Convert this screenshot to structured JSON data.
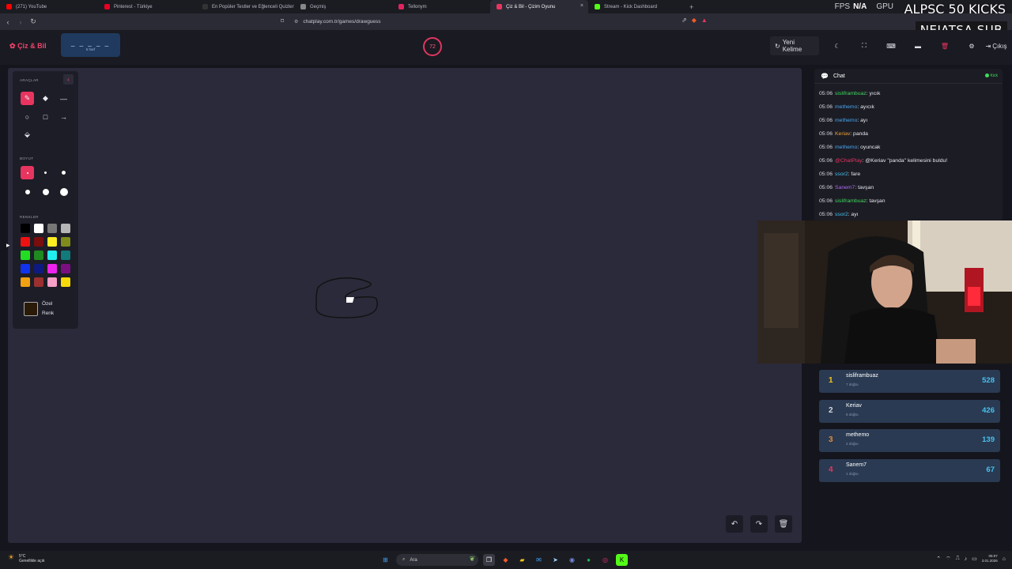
{
  "browser": {
    "tabs": [
      {
        "label": "(271) YouTube",
        "color": "#ff0000"
      },
      {
        "label": "Pinterest - Türkiye",
        "color": "#e60023"
      },
      {
        "label": "En Popüler Testler ve Eğlenceli Quizler",
        "color": "#333333"
      },
      {
        "label": "Geçmiş",
        "color": "#888888"
      },
      {
        "label": "Tellonym",
        "color": "#e0245e"
      },
      {
        "label": "Çiz & Bil - Çizim Oyunu",
        "color": "#e8355f",
        "active": true
      },
      {
        "label": "Stream - Kick Dashboard",
        "color": "#53fc18"
      }
    ],
    "close_glyph": "×",
    "new_tab": "+",
    "url": "chatplay.com.tr/games/drawguess",
    "hud": {
      "fps_label": "FPS",
      "fps_value": "N/A",
      "gpu_label": "GPU"
    }
  },
  "overlay": {
    "top_text": "ALPSC 50 KICKS",
    "box_text": "NEJATSA SUB"
  },
  "app": {
    "logo": "Çiz & Bil",
    "word_blanks": "_ _ _ _ _",
    "word_letters": "5 harf",
    "timer": "72",
    "new_word_label": "Yeni Kelime",
    "exit_label": "Çıkış",
    "header_icons": [
      "moon-icon",
      "fullscreen-icon",
      "keyboard-icon",
      "layout-icon",
      "trash-icon",
      "gear-icon"
    ]
  },
  "toolbox": {
    "tools_title": "ARAÇLAR",
    "size_title": "BOYUT",
    "colors_title": "RENKLER",
    "custom_label": "Özel Renk",
    "colors": [
      [
        "#000000",
        "#ffffff",
        "#777777",
        "#b5b5b5"
      ],
      [
        "#ee1111",
        "#7a0d0d",
        "#ffee22",
        "#7f8c1b"
      ],
      [
        "#22dd22",
        "#1f8a1f",
        "#22eeee",
        "#127a7a"
      ],
      [
        "#1133ee",
        "#0f1a80",
        "#ee22ee",
        "#7a1080"
      ],
      [
        "#f0a010",
        "#9a3030",
        "#f7a0c8",
        "#f5d90a"
      ]
    ]
  },
  "chat": {
    "title": "Chat",
    "platform": "Kick",
    "messages": [
      {
        "time": "05:06",
        "user": "sisliframbuaz",
        "user_color": "#3ddc5a",
        "text": ": yıcık"
      },
      {
        "time": "05:06",
        "user": "methemo",
        "user_color": "#45a8f0",
        "text": ": ayıcık"
      },
      {
        "time": "05:06",
        "user": "methemo",
        "user_color": "#45a8f0",
        "text": ": ayı"
      },
      {
        "time": "05:06",
        "user": "Keriav",
        "user_color": "#f0a030",
        "text": ": panda"
      },
      {
        "time": "05:06",
        "user": "methemo",
        "user_color": "#45a8f0",
        "text": ": oyuncak"
      },
      {
        "time": "05:06",
        "user": "@ChatPlay",
        "user_color": "#e8355f",
        "text": ": @Keriav \"panda\" kelimesini buldu!"
      },
      {
        "time": "05:06",
        "user": "ssor2",
        "user_color": "#45c2f0",
        "text": ": fare"
      },
      {
        "time": "05:06",
        "user": "Sanem7",
        "user_color": "#b06af0",
        "text": ": tavşan"
      },
      {
        "time": "05:06",
        "user": "sisliframbuaz",
        "user_color": "#3ddc5a",
        "text": ": tavşan"
      },
      {
        "time": "05:06",
        "user": "ssor2",
        "user_color": "#45c2f0",
        "text": ": ayı"
      }
    ]
  },
  "leaderboard": [
    {
      "rank": "1",
      "rank_color": "#f5c518",
      "name": "sisliframbuaz",
      "sub": "7 doğru",
      "score": "528"
    },
    {
      "rank": "2",
      "rank_color": "#d8d8e0",
      "name": "Keriav",
      "sub": "6 doğru",
      "score": "426"
    },
    {
      "rank": "3",
      "rank_color": "#e08a3c",
      "name": "methemo",
      "sub": "2 doğru",
      "score": "139"
    },
    {
      "rank": "4",
      "rank_color": "#e8355f",
      "name": "Sanem7",
      "sub": "1 doğru",
      "score": "67"
    }
  ],
  "taskbar": {
    "weather_temp": "5°C",
    "weather_desc": "Genellikle açık",
    "search": "Ara",
    "time": "05:07",
    "date": "3.01.2026"
  }
}
